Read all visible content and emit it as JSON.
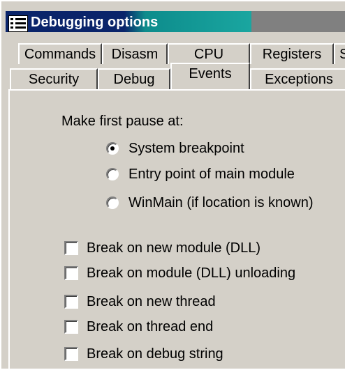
{
  "window": {
    "title": "Debugging options"
  },
  "tabs_back_row": [
    {
      "label": "Commands"
    },
    {
      "label": "Disasm"
    },
    {
      "label": "CPU"
    },
    {
      "label": "Registers"
    },
    {
      "label": "S"
    }
  ],
  "tabs_front_row": [
    {
      "label": "Security"
    },
    {
      "label": "Debug"
    },
    {
      "label": "Events",
      "active": true
    },
    {
      "label": "Exceptions"
    }
  ],
  "first_pause": {
    "heading": "Make first pause at:",
    "options": [
      {
        "label": "System breakpoint",
        "selected": true
      },
      {
        "label": "Entry point of main module",
        "selected": false
      },
      {
        "label": "WinMain (if location is known)",
        "selected": false
      }
    ]
  },
  "breaks": [
    {
      "label": "Break on new module (DLL)",
      "checked": false
    },
    {
      "label": "Break on module (DLL) unloading",
      "checked": false
    },
    {
      "label": "Break on new thread",
      "checked": false
    },
    {
      "label": "Break on thread end",
      "checked": false
    },
    {
      "label": "Break on debug string",
      "checked": false
    }
  ]
}
